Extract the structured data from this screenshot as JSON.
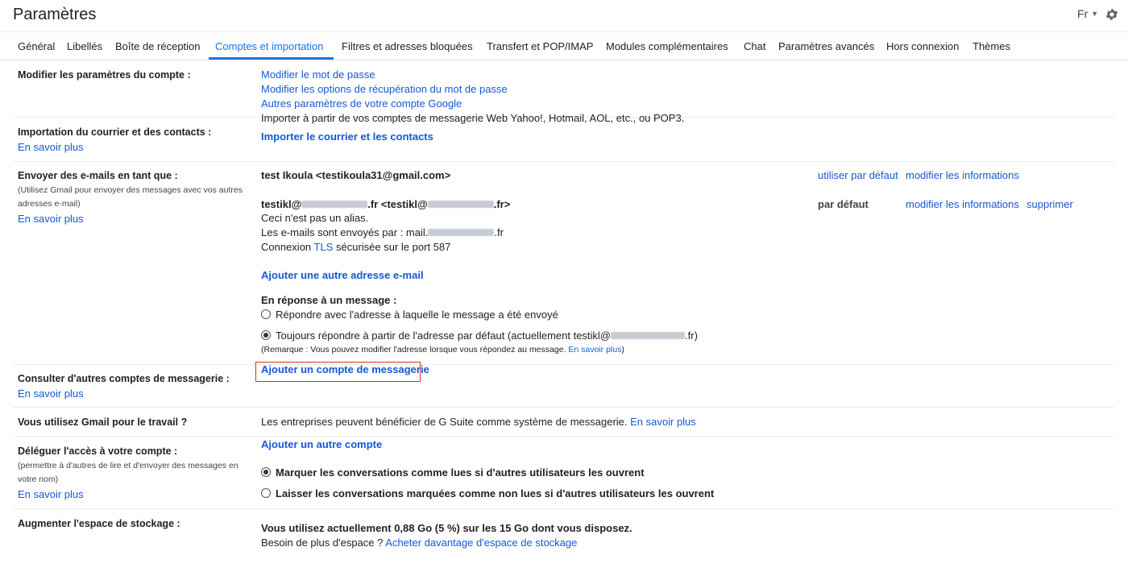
{
  "header": {
    "title": "Paramètres",
    "lang": "Fr"
  },
  "tabs": [
    "Général",
    "Libellés",
    "Boîte de réception",
    "Comptes et importation",
    "Filtres et adresses bloquées",
    "Transfert et POP/IMAP",
    "Modules complémentaires",
    "Chat",
    "Paramètres avancés",
    "Hors connexion",
    "Thèmes"
  ],
  "change_account": {
    "label": "Modifier les paramètres du compte :",
    "links": [
      "Modifier le mot de passe",
      "Modifier les options de récupération du mot de passe",
      "Autres paramètres de votre compte Google"
    ]
  },
  "import": {
    "label": "Importation du courrier et des contacts :",
    "learn_more": "En savoir plus",
    "desc": "Importer à partir de vos comptes de messagerie Web Yahoo!, Hotmail, AOL, etc., ou POP3.",
    "action": "Importer le courrier et les contacts"
  },
  "send_as": {
    "label": "Envoyer des e-mails en tant que :",
    "sub1": "(Utilisez Gmail pour envoyer des messages avec vos autres",
    "sub2": "adresses e-mail)",
    "learn_more": "En savoir plus",
    "addr1": "test Ikoula <testikoula31@gmail.com>",
    "addr1_default_link": "utiliser par défaut",
    "edit_info": "modifier les informations",
    "addr2_prefix": "testikl@",
    "addr2_mid": ".fr <testikl@",
    "addr2_end": ".fr>",
    "default_label": "par défaut",
    "delete": "supprimer",
    "not_alias": "Ceci n'est pas un alias.",
    "sent_via_prefix": "Les e-mails sont envoyés par : mail.",
    "sent_via_suffix": ".fr",
    "conn_prefix": "Connexion ",
    "conn_tls": "TLS",
    "conn_suffix": " sécurisée sur le port 587",
    "add_another": "Ajouter une autre adresse e-mail",
    "reply_heading": "En réponse à un message :",
    "reply_opt1": "Répondre avec l'adresse à laquelle le message a été envoyé",
    "reply_opt2_prefix": "Toujours répondre à partir de l'adresse par défaut (actuellement testikl@",
    "reply_opt2_suffix": ".fr)",
    "note": "(Remarque : Vous pouvez modifier l'adresse lorsque vous répondez au message.",
    "note_link": "En savoir plus",
    "note_end": ")"
  },
  "check_mail": {
    "label": "Consulter d'autres comptes de messagerie :",
    "learn_more": "En savoir plus",
    "action": "Ajouter un compte de messagerie"
  },
  "work": {
    "label": "Vous utilisez Gmail pour le travail ?",
    "desc": "Les entreprises peuvent bénéficier de G Suite comme système de messagerie.",
    "learn_more": "En savoir plus"
  },
  "delegate": {
    "label": "Déléguer l'accès à votre compte :",
    "sub1": "(permettre à d'autres de lire et d'envoyer des messages en",
    "sub2": "votre nom)",
    "learn_more": "En savoir plus",
    "add": "Ajouter un autre compte",
    "opt1": "Marquer les conversations comme lues si d'autres utilisateurs les ouvrent",
    "opt2": "Laisser les conversations marquées comme non lues si d'autres utilisateurs les ouvrent"
  },
  "storage": {
    "label": "Augmenter l'espace de stockage :",
    "usage": "Vous utilisez actuellement 0,88 Go (5 %) sur les 15 Go dont vous disposez.",
    "need": "Besoin de plus d'espace ?",
    "buy": "Acheter davantage d'espace de stockage"
  }
}
